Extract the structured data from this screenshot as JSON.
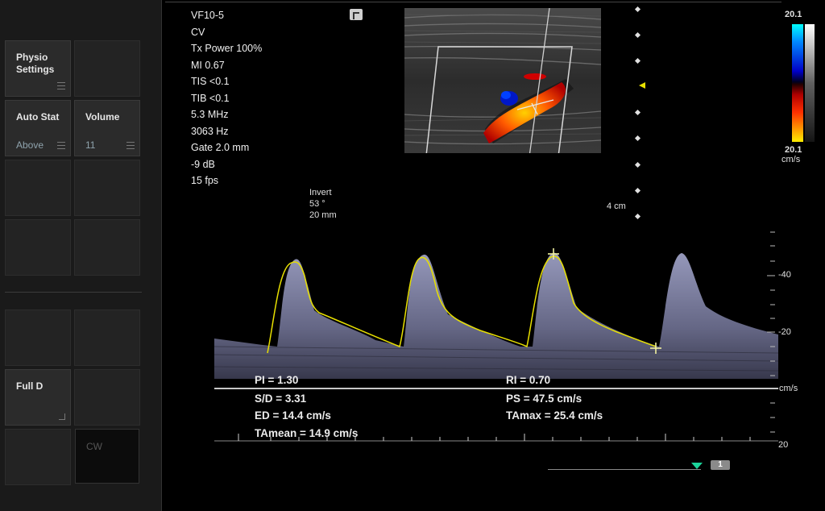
{
  "sidebar": {
    "physio": {
      "label_line1": "Physio",
      "label_line2": "Settings"
    },
    "auto_stat": {
      "label": "Auto Stat",
      "value": "Above"
    },
    "volume": {
      "label": "Volume",
      "value": "11"
    },
    "full_d": {
      "label": "Full D"
    },
    "cw": {
      "label": "CW"
    }
  },
  "params": [
    "VF10-5",
    "CV",
    "Tx Power 100%",
    "MI 0.67",
    "TIS <0.1",
    "TIB <0.1",
    "5.3 MHz",
    "3063 Hz",
    "Gate 2.0 mm",
    "-9 dB",
    "15 fps"
  ],
  "doppler_info": {
    "invert": "Invert",
    "angle": "53 °",
    "depth": "20 mm"
  },
  "depth_label": "4 cm",
  "color_scale": {
    "top": "20.1",
    "bottom": "20.1",
    "unit": "cm/s"
  },
  "spectral_scale": {
    "ticks": [
      "-40",
      "-20",
      "20"
    ],
    "unit": "cm/s"
  },
  "measurements": {
    "pi": "PI = 1.30",
    "sd": "S/D = 3.31",
    "ed": "ED = 14.4 cm/s",
    "tamean": "TAmean = 14.9 cm/s",
    "ri": "RI = 0.70",
    "ps": "PS = 47.5 cm/s",
    "tamax": "TAmax = 25.4 cm/s"
  },
  "cine_badge": "1",
  "colors": {
    "trace": "#e8e000",
    "cine_marker": "#1bd39a"
  }
}
